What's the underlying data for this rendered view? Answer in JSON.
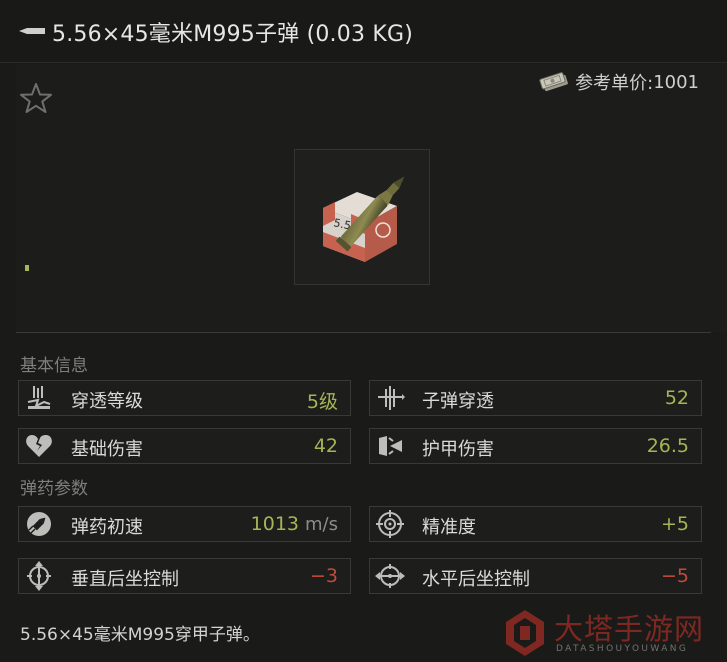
{
  "title": "5.56×45毫米M995子弹 (0.03 KG)",
  "price": {
    "label": "参考单价:",
    "value": "1001",
    "icon": "money-stack-icon"
  },
  "favorite_icon": "star-outline-icon",
  "sections": {
    "basic": {
      "title": "基本信息",
      "stats": [
        {
          "label": "穿透等级",
          "value": "5级",
          "icon": "penetration-level-icon",
          "color": "#a6b455"
        },
        {
          "label": "子弹穿透",
          "value": "52",
          "icon": "bullet-penetration-icon",
          "color": "#a6b455"
        },
        {
          "label": "基础伤害",
          "value": "42",
          "icon": "broken-heart-icon",
          "color": "#a6b455"
        },
        {
          "label": "护甲伤害",
          "value": "26.5",
          "icon": "armor-damage-icon",
          "color": "#a6b455"
        }
      ]
    },
    "ammo": {
      "title": "弹药参数",
      "stats": [
        {
          "label": "弹药初速",
          "value": "1013",
          "unit": "m/s",
          "icon": "muzzle-velocity-icon",
          "color": "#a6b455"
        },
        {
          "label": "精准度",
          "value": "+5",
          "icon": "crosshair-icon",
          "color": "#a6b455"
        },
        {
          "label": "垂直后坐控制",
          "value": "−3",
          "icon": "vertical-recoil-icon",
          "color": "#c24a3d"
        },
        {
          "label": "水平后坐控制",
          "value": "−5",
          "icon": "horizontal-recoil-icon",
          "color": "#c24a3d"
        }
      ]
    }
  },
  "description": "5.56×45毫米M995穿甲子弹。",
  "watermark": {
    "text": "大塔手游网",
    "sub": "DATASHOUYOUWANG"
  }
}
